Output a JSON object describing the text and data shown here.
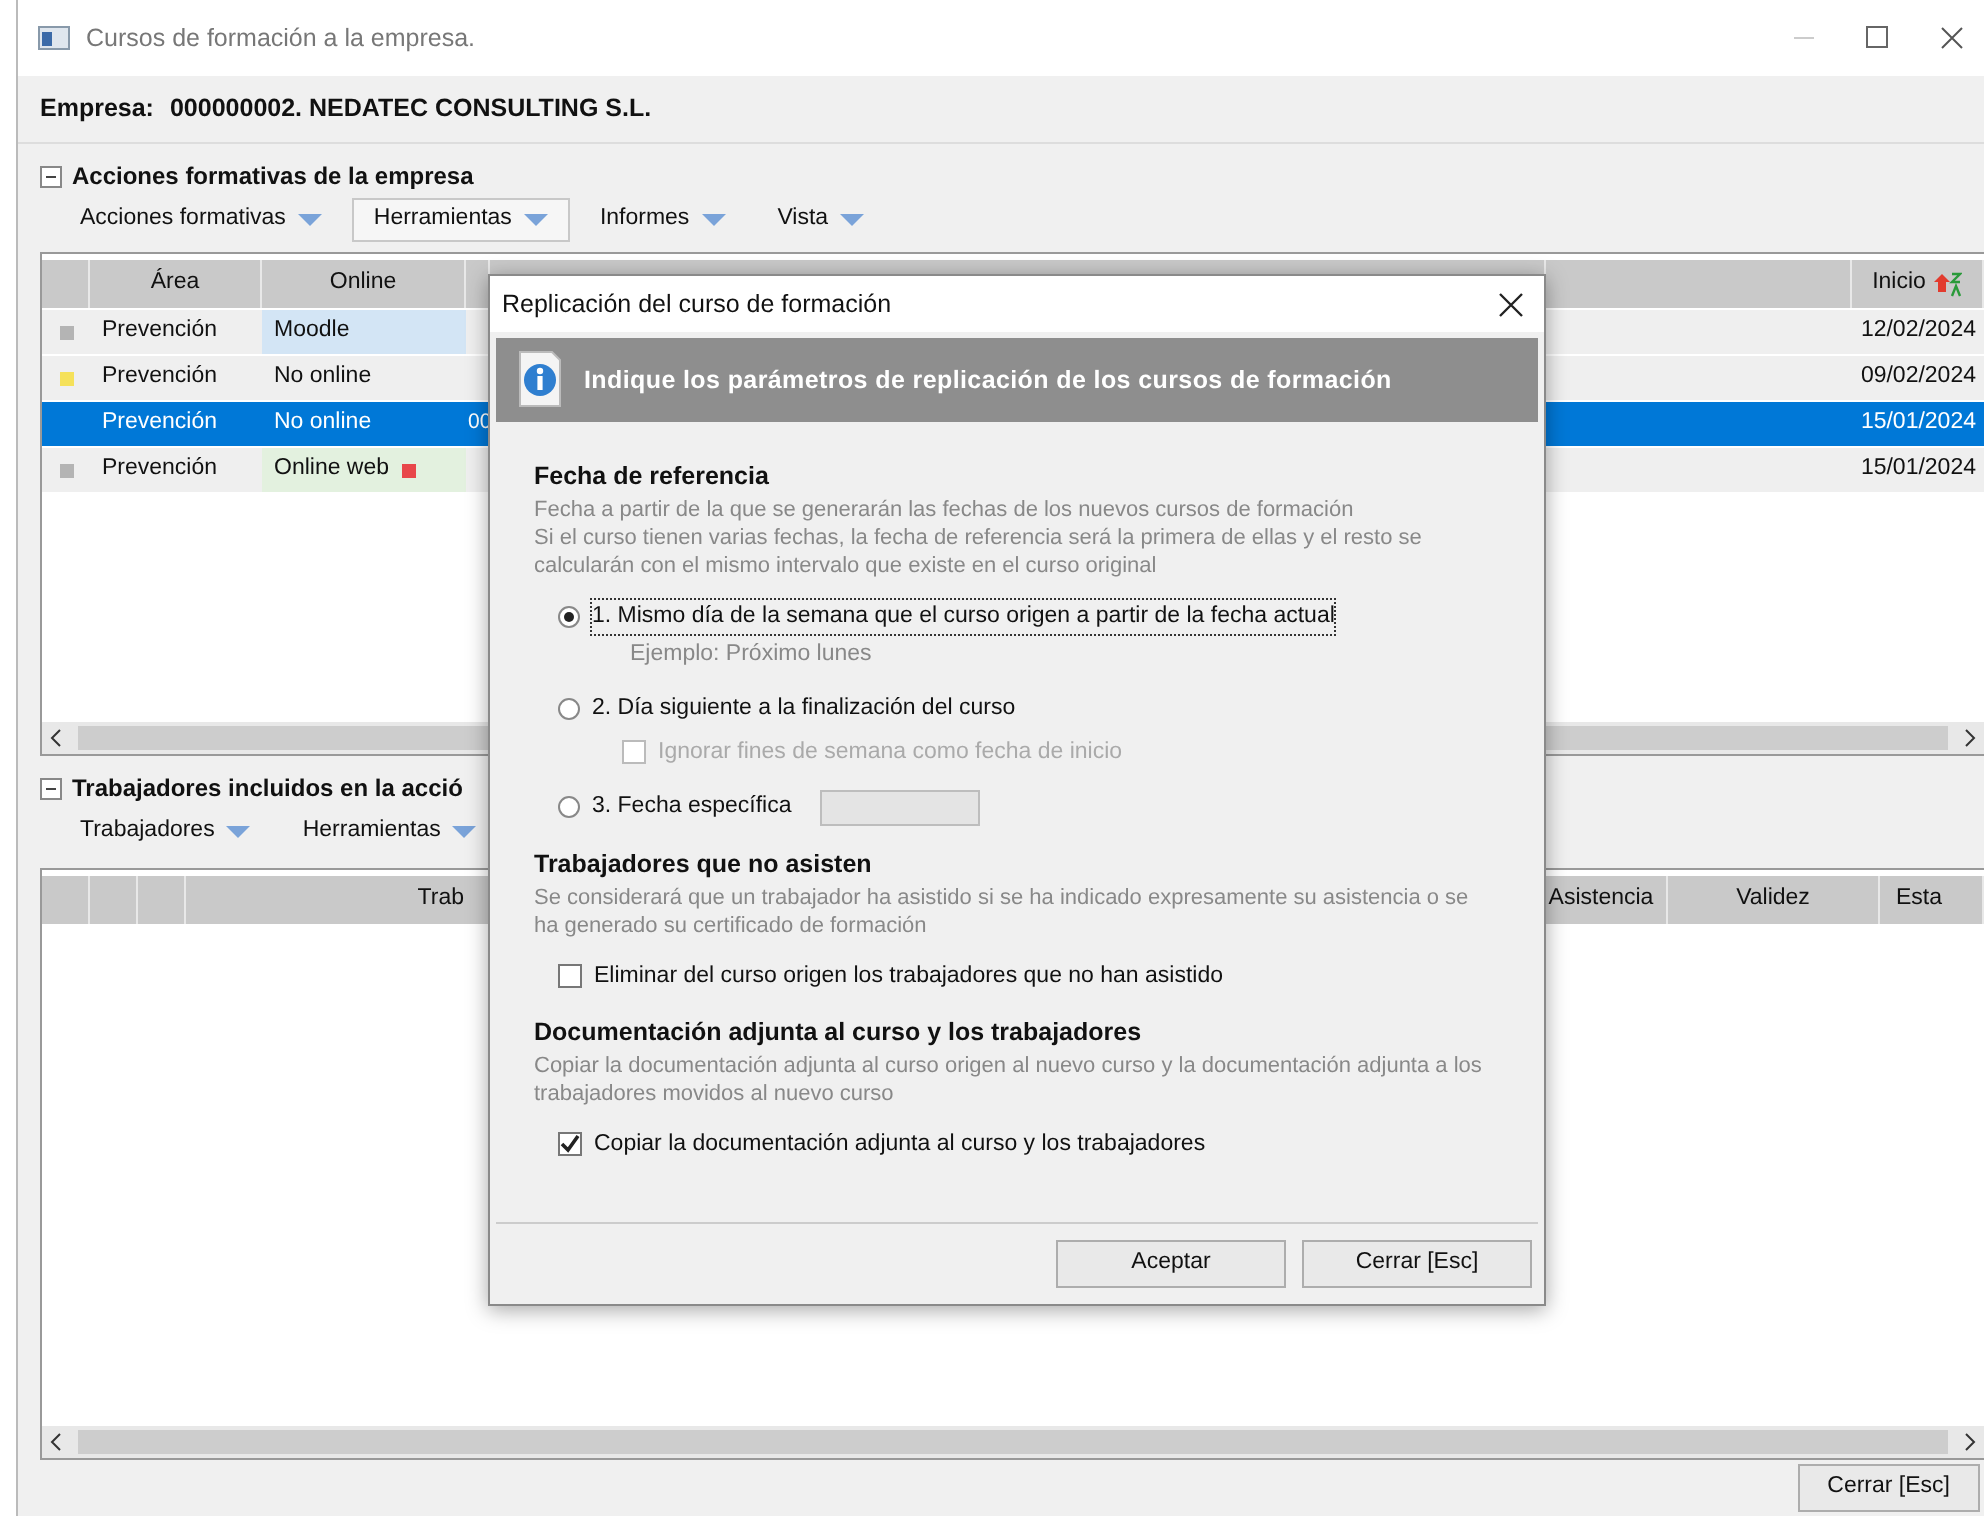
{
  "window": {
    "title": "Cursos de formación a la empresa."
  },
  "company": {
    "label": "Empresa:",
    "value": "000000002. NEDATEC CONSULTING S.L."
  },
  "courses_section": {
    "title": "Acciones formativas de la empresa",
    "expanded": true,
    "toolbar": [
      {
        "label": "Acciones formativas",
        "highlighted": false
      },
      {
        "label": "Herramientas",
        "highlighted": true
      },
      {
        "label": "Informes",
        "highlighted": false
      },
      {
        "label": "Vista",
        "highlighted": false
      }
    ],
    "columns": [
      {
        "label": "Área"
      },
      {
        "label": "Online"
      },
      {
        "label": "Inicio",
        "sorted": true
      }
    ],
    "rows": [
      {
        "status": {
          "color": "#b4b4b4"
        },
        "area": "Prevención",
        "online": {
          "text": "Moodle",
          "color": "#d3e5f5"
        },
        "inicio": "12/02/2024",
        "selected": false
      },
      {
        "status": {
          "color": "#f5e15a"
        },
        "area": "Prevención",
        "online": {
          "text": "No online"
        },
        "inicio": "09/02/2024",
        "selected": false
      },
      {
        "area": "Prevención",
        "online": {
          "text": "No online"
        },
        "column_3": "00",
        "inicio": "15/01/2024",
        "selected": true
      },
      {
        "status": {
          "color": "#b4b4b4"
        },
        "area": "Prevención",
        "online": {
          "text": "Online web",
          "color": "#e3f1df",
          "marker": {
            "color": "#e8474a"
          }
        },
        "inicio": "15/01/2024",
        "selected": false
      }
    ]
  },
  "workers_section": {
    "title": "Trabajadores incluidos en la acció",
    "expanded": true,
    "toolbar": [
      {
        "label": "Trabajadores",
        "highlighted": false
      },
      {
        "label": "Herramientas",
        "highlighted": false
      }
    ],
    "columns": [
      {
        "label": "Trab"
      },
      {
        "label": "Asistencia"
      },
      {
        "label": "Validez"
      },
      {
        "label": "Esta"
      }
    ]
  },
  "footer_button": {
    "label": "Cerrar [Esc]"
  },
  "dialog": {
    "title": "Replicación del curso de formación",
    "banner": "Indique los parámetros de replicación de los cursos de formación",
    "sections": [
      {
        "heading": "Fecha de referencia",
        "description": [
          "Fecha a partir de la que se generarán las fechas de los nuevos cursos de formación",
          "Si el curso tienen varias fechas, la fecha de referencia será la primera de ellas y el resto se calcularán con el mismo intervalo que existe en el curso original"
        ],
        "options": [
          {
            "kind": "radio",
            "label": "1. Mismo día de la semana que el curso origen a partir de la fecha actual",
            "selected": true,
            "focused": true,
            "hint": "Ejemplo: Próximo lunes"
          },
          {
            "kind": "radio",
            "label": "2. Día siguiente a la finalización del curso",
            "selected": false,
            "focused": false,
            "sub_option": {
              "label": "Ignorar fines de semana como fecha de inicio",
              "checked": false,
              "disabled": true
            }
          },
          {
            "kind": "radio",
            "label": "3. Fecha específica",
            "selected": false,
            "focused": false,
            "field": {
              "disabled": true
            }
          }
        ]
      },
      {
        "heading": "Trabajadores que no asisten",
        "description": [
          "Se considerará que un trabajador ha asistido si se ha indicado expresamente su asistencia o se ha generado su certificado de formación"
        ],
        "options": [
          {
            "kind": "checkbox",
            "label": "Eliminar del curso origen los trabajadores que no han asistido",
            "checked": false
          }
        ]
      },
      {
        "heading": "Documentación adjunta al curso y los trabajadores",
        "description": [
          "Copiar la documentación adjunta al curso origen al nuevo curso y la documentación adjunta a los trabajadores movidos al nuevo curso"
        ],
        "options": [
          {
            "kind": "checkbox",
            "label": "Copiar la documentación adjunta al curso y los trabajadores",
            "checked": true
          }
        ]
      }
    ],
    "buttons": [
      {
        "label": "Aceptar"
      },
      {
        "label": "Cerrar [Esc]"
      }
    ]
  }
}
